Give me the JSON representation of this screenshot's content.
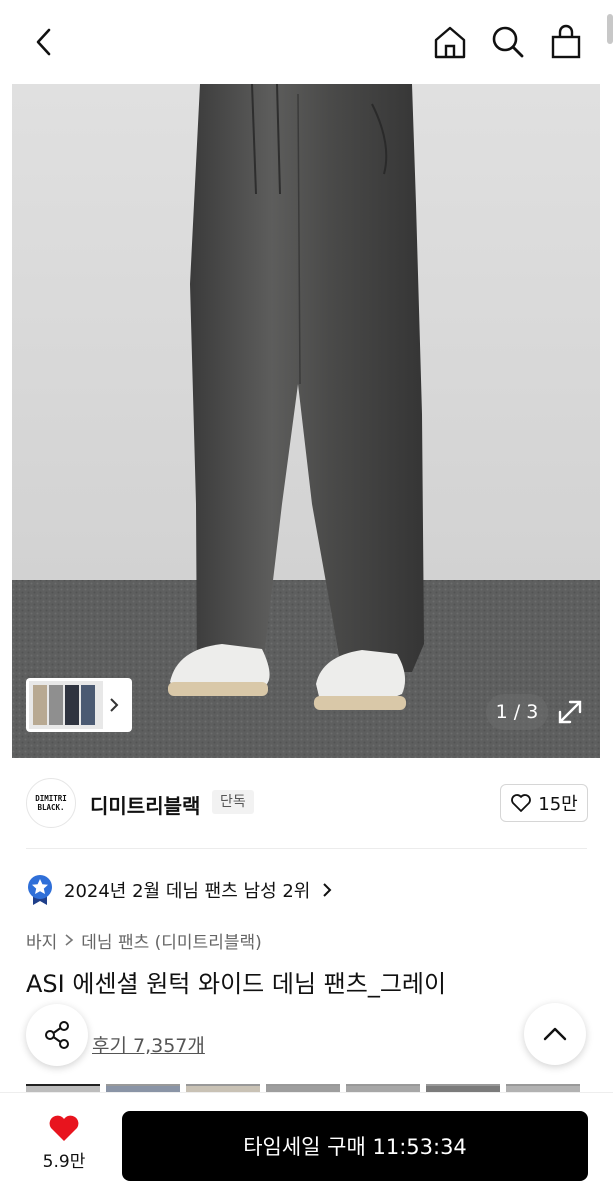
{
  "header": {
    "back_icon": "chevron-left-icon",
    "home_icon": "home-icon",
    "search_icon": "search-icon",
    "cart_icon": "shopping-bag-icon"
  },
  "gallery": {
    "counter": "1 / 3",
    "expand_icon": "expand-icon",
    "thumb_arrow_icon": "chevron-right-icon"
  },
  "brand": {
    "logo_line1": "DIMITRI",
    "logo_line2": "BLACK.",
    "name": "디미트리블랙",
    "badge": "단독",
    "like_count": "15만"
  },
  "rank": {
    "text": "2024년 2월 데님 팬츠 남성 2위",
    "accent": "#2f6fd8"
  },
  "breadcrumb": {
    "level1": "바지",
    "level2": "데님 팬츠 (디미트리블랙)"
  },
  "product": {
    "title": "ASI 에센셜 원턱 와이드 데님 팬츠_그레이",
    "review_label": "후기 7,357개"
  },
  "bottom": {
    "heart_count": "5.9만",
    "heart_color": "#e8141e",
    "buy_label": "타임세일 구매 11:53:34"
  }
}
